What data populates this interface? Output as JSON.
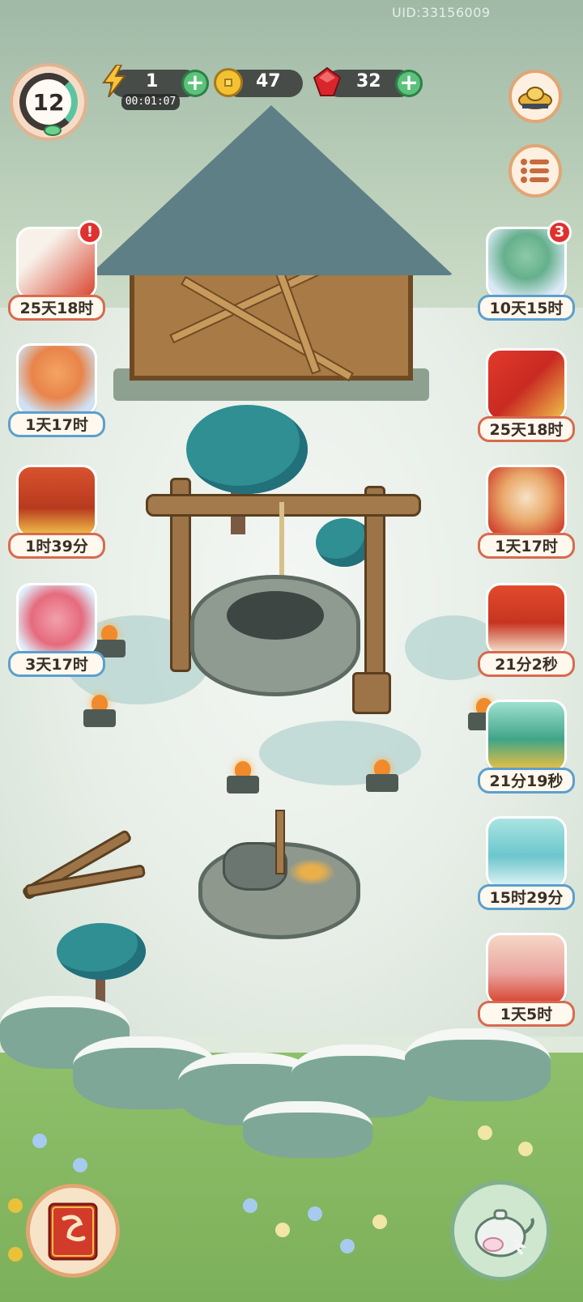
{
  "uid": "UID:33156009",
  "player": {
    "level": "12"
  },
  "resources": {
    "energy": {
      "value": "1",
      "timer": "00:01:07",
      "icon": "lightning-icon"
    },
    "coins": {
      "value": "47",
      "icon": "coin-icon"
    },
    "rubies": {
      "value": "32",
      "icon": "ruby-icon"
    }
  },
  "right_buttons": [
    {
      "name": "treasure-shop",
      "icon": "gold-ingot-icon"
    },
    {
      "name": "menu",
      "icon": "list-icon"
    }
  ],
  "left_events": [
    {
      "label": "25天18时",
      "badge": "!",
      "theme": "blossom-scroll"
    },
    {
      "label": "1天17时",
      "theme": "fox-cub"
    },
    {
      "label": "1时39分",
      "theme": "treasure-chest"
    },
    {
      "label": "3天17时",
      "theme": "flower-lion"
    }
  ],
  "right_events": [
    {
      "label": "10天15时",
      "badge": "3",
      "theme": "cloud-cat"
    },
    {
      "label": "25天18时",
      "theme": "red-envelope"
    },
    {
      "label": "1天17时",
      "theme": "lucky-cat"
    },
    {
      "label": "21分2秒",
      "theme": "red-cake"
    },
    {
      "label": "21分19秒",
      "theme": "cat-coin-cart"
    },
    {
      "label": "15时29分",
      "theme": "gift-box-cat"
    },
    {
      "label": "1天5时",
      "theme": "shop-girl"
    }
  ],
  "colors": {
    "label_red": "#d86a4f",
    "label_blue": "#5c9fce",
    "plus_green": "#5bc27a",
    "badge_red": "#e0312f"
  }
}
